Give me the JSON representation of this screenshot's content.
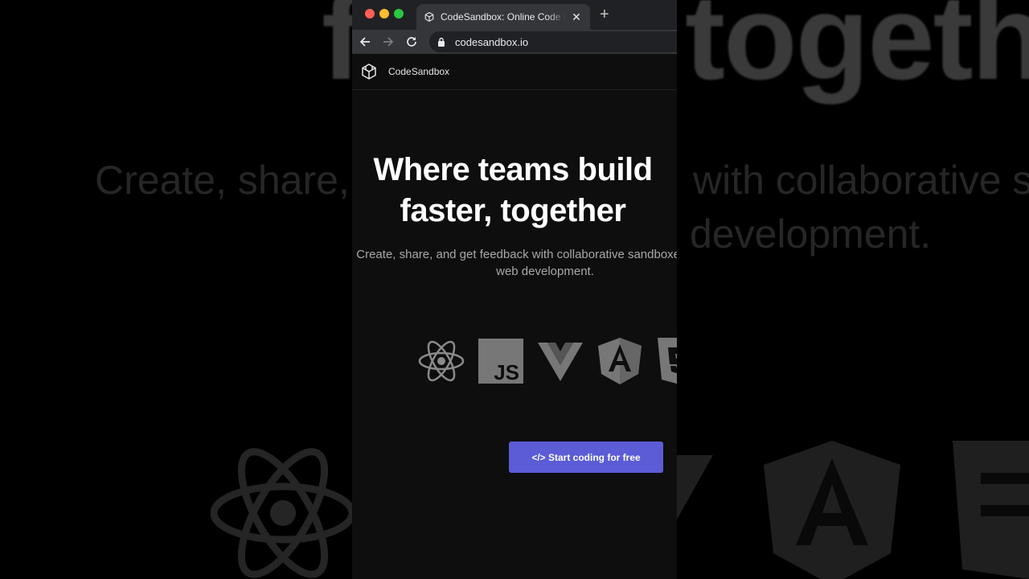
{
  "browser": {
    "tab_title": "CodeSandbox: Online Code Editor and IDE for Rapid Web Development",
    "tab_favicon": "codesandbox-cube-icon",
    "close_icon": "close-icon",
    "new_tab_icon": "plus-icon",
    "url": "codesandbox.io",
    "traffic_colors": [
      "#ff5f57",
      "#febc2e",
      "#28c840"
    ]
  },
  "site": {
    "brand": "CodeSandbox",
    "headline_line1": "Where teams build",
    "headline_line2": "faster, together",
    "subtitle_line1": "Create, share, and get feedback with collaborative sandboxes for rapid",
    "subtitle_line2": "web development.",
    "framework_icons": [
      "react-icon",
      "javascript-icon",
      "vue-icon",
      "angular-icon",
      "html5-icon"
    ],
    "cta_label": "</> Start coding for free",
    "accent": "#5b5cd6"
  },
  "backdrop": {
    "top_word_left": "fa",
    "top_word_right": "togeth",
    "line1_left": "Create, share,",
    "line1_right": "with collaborative s",
    "line2_right": "development."
  }
}
